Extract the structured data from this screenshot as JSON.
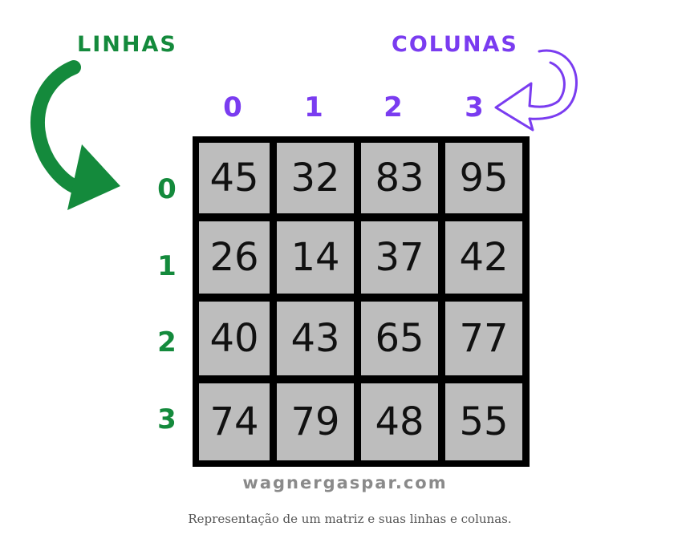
{
  "labels": {
    "rows": "LINHAS",
    "columns": "COLUNAS"
  },
  "column_indices": [
    "0",
    "1",
    "2",
    "3"
  ],
  "row_indices": [
    "0",
    "1",
    "2",
    "3"
  ],
  "matrix": [
    [
      "45",
      "32",
      "83",
      "95"
    ],
    [
      "26",
      "14",
      "37",
      "42"
    ],
    [
      "40",
      "43",
      "65",
      "77"
    ],
    [
      "74",
      "79",
      "48",
      "55"
    ]
  ],
  "watermark": "wagnergaspar.com",
  "caption": "Representação de um matriz e suas linhas e colunas.",
  "colors": {
    "rows": "#148a3c",
    "columns": "#7a3cf0",
    "cell": "#bdbdbd",
    "grid": "#000000"
  }
}
